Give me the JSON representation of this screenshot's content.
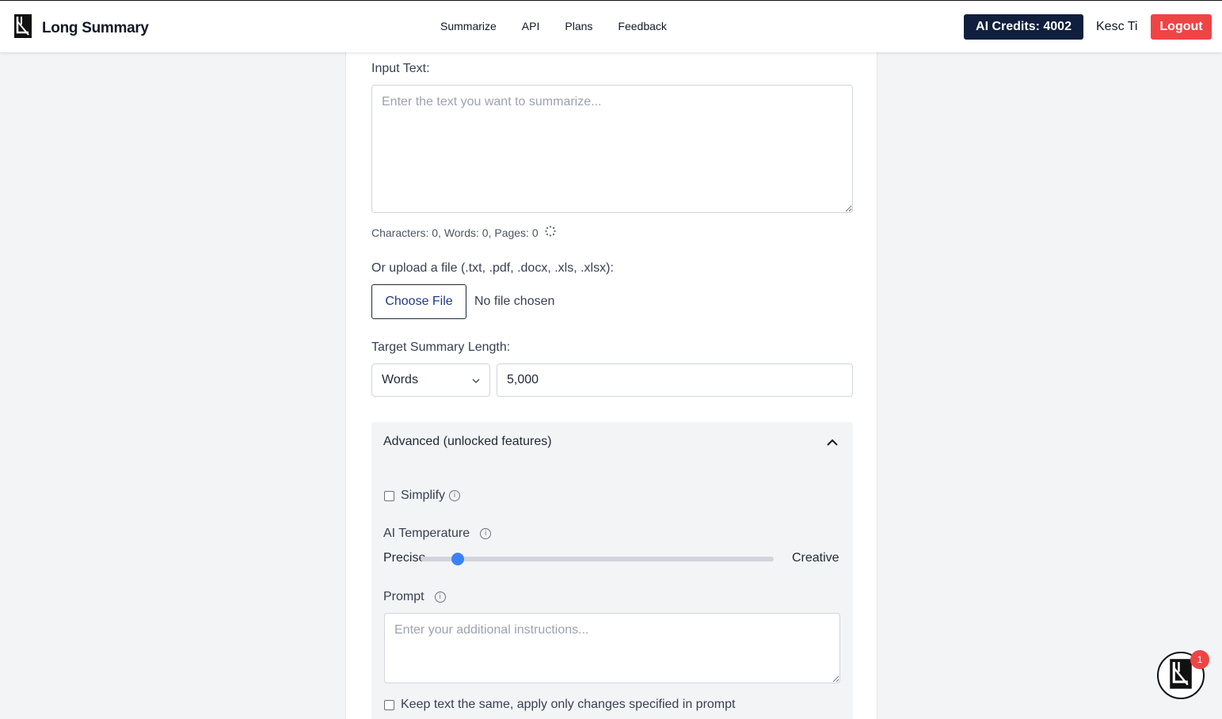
{
  "header": {
    "brand": "Long Summary",
    "nav": [
      "Summarize",
      "API",
      "Plans",
      "Feedback"
    ],
    "credits": "AI Credits: 4002",
    "user": "Kesc Ti",
    "logout": "Logout"
  },
  "form": {
    "input_label": "Input Text:",
    "input_placeholder": "Enter the text you want to summarize...",
    "counts": "Characters: 0, Words: 0, Pages: 0",
    "upload_label": "Or upload a file (.txt, .pdf, .docx, .xls, .xlsx):",
    "choose_file": "Choose File",
    "no_file": "No file chosen",
    "target_label": "Target Summary Length:",
    "unit_selected": "Words",
    "target_value": "5,000"
  },
  "advanced": {
    "title": "Advanced (unlocked features)",
    "simplify_label": "Simplify",
    "temperature_label": "AI Temperature",
    "precise": "Precise",
    "creative": "Creative",
    "temperature_level": 0.09,
    "prompt_label": "Prompt",
    "prompt_placeholder": "Enter your additional instructions...",
    "keep_text_label": "Keep text the same, apply only changes specified in prompt"
  },
  "chat": {
    "badge": "1"
  }
}
